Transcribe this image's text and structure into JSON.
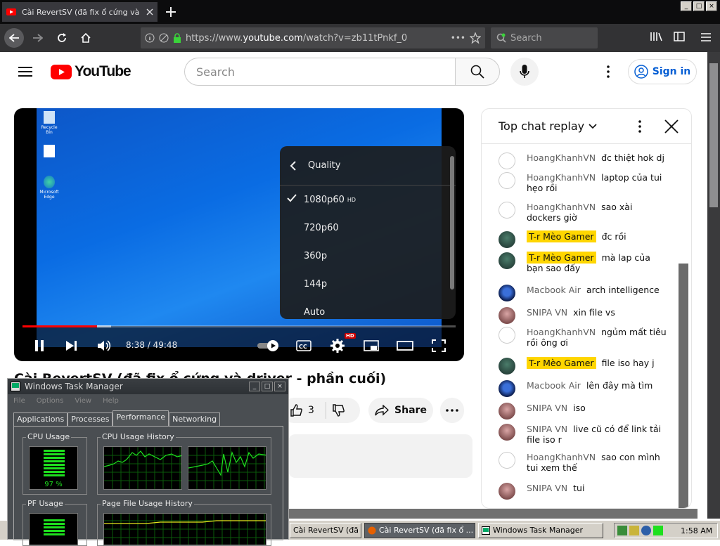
{
  "browser": {
    "tab_title": "Cài RevertSV (đã fix ổ cứng và dr",
    "new_tab": "+",
    "url_prefix": "https://www.",
    "url_domain": "youtube.com",
    "url_path": "/watch?v=zb11tPnkf_0",
    "url_dots": "•••",
    "search_placeholder": "Search",
    "window_min": "_",
    "window_max": "□",
    "window_close": "×"
  },
  "youtube": {
    "logo_text": "YouTube",
    "search_placeholder": "Search",
    "sign_in": "Sign in",
    "video_title": "Cài RevertSV (đã fix ổ cứng và driver - phần cuối)",
    "likes": "3",
    "share": "Share"
  },
  "player": {
    "timecode": "8:38 / 49:48",
    "progress_played_fraction": 0.172,
    "progress_buffered_fraction": 0.205,
    "hd_badge": "HD",
    "desktop_icons": [
      "Recycle Bin",
      "",
      "Microsoft Edge"
    ],
    "quality_menu": {
      "title": "Quality",
      "options": [
        {
          "label": "1080p60",
          "badge": "HD",
          "selected": true
        },
        {
          "label": "720p60",
          "badge": "",
          "selected": false
        },
        {
          "label": "360p",
          "badge": "",
          "selected": false
        },
        {
          "label": "144p",
          "badge": "",
          "selected": false
        },
        {
          "label": "Auto",
          "badge": "",
          "selected": false
        }
      ]
    }
  },
  "chat": {
    "header": "Top chat replay",
    "messages": [
      {
        "author": "HoangKhanhVN",
        "text": "đc thiệt hok dj",
        "avatar": "default",
        "owner": false
      },
      {
        "author": "HoangKhanhVN",
        "text": "laptop của tui hẹo rồi",
        "avatar": "default",
        "owner": false
      },
      {
        "author": "HoangKhanhVN",
        "text": "sao xài dockers giờ",
        "avatar": "default",
        "owner": false
      },
      {
        "author": "T-r Mèo Gamer",
        "text": "đc rồi",
        "avatar": "tr",
        "owner": true
      },
      {
        "author": "T-r Mèo Gamer",
        "text": "mà lap của bạn sao đấy",
        "avatar": "tr",
        "owner": true
      },
      {
        "author": "Macbook Air",
        "text": "arch intelligence",
        "avatar": "mac",
        "owner": false
      },
      {
        "author": "SNIPA VN",
        "text": "xin file vs",
        "avatar": "sn",
        "owner": false
      },
      {
        "author": "HoangKhanhVN",
        "text": "ngủm mất tiêu rồi ông ơi",
        "avatar": "default",
        "owner": false
      },
      {
        "author": "T-r Mèo Gamer",
        "text": "file iso hay j",
        "avatar": "tr",
        "owner": true
      },
      {
        "author": "Macbook Air",
        "text": "lên đây mà tìm",
        "avatar": "mac",
        "owner": false
      },
      {
        "author": "SNIPA VN",
        "text": "iso",
        "avatar": "sn",
        "owner": false
      },
      {
        "author": "SNIPA VN",
        "text": "live cũ có để link tải file iso r",
        "avatar": "sn",
        "owner": false
      },
      {
        "author": "HoangKhanhVN",
        "text": "sao con mình tui xem thế",
        "avatar": "default",
        "owner": false
      },
      {
        "author": "SNIPA VN",
        "text": "tui",
        "avatar": "sn",
        "owner": false
      }
    ]
  },
  "taskmanager": {
    "title": "Windows Task Manager",
    "menu": [
      "File",
      "Options",
      "View",
      "Help"
    ],
    "tabs": [
      "Applications",
      "Processes",
      "Performance",
      "Networking"
    ],
    "active_tab": "Performance",
    "cpu_usage_label": "CPU Usage",
    "cpu_usage_value": "97 %",
    "cpu_history_label": "CPU Usage History",
    "pf_usage_label": "PF Usage",
    "pf_history_label": "Page File Usage History"
  },
  "taskbar": {
    "tasks": [
      "Cài RevertSV (đã fix ổ cứ...",
      "Cài RevertSV (đã fix ổ ...",
      "Windows Task Manager"
    ],
    "clock": "1:58 AM"
  }
}
